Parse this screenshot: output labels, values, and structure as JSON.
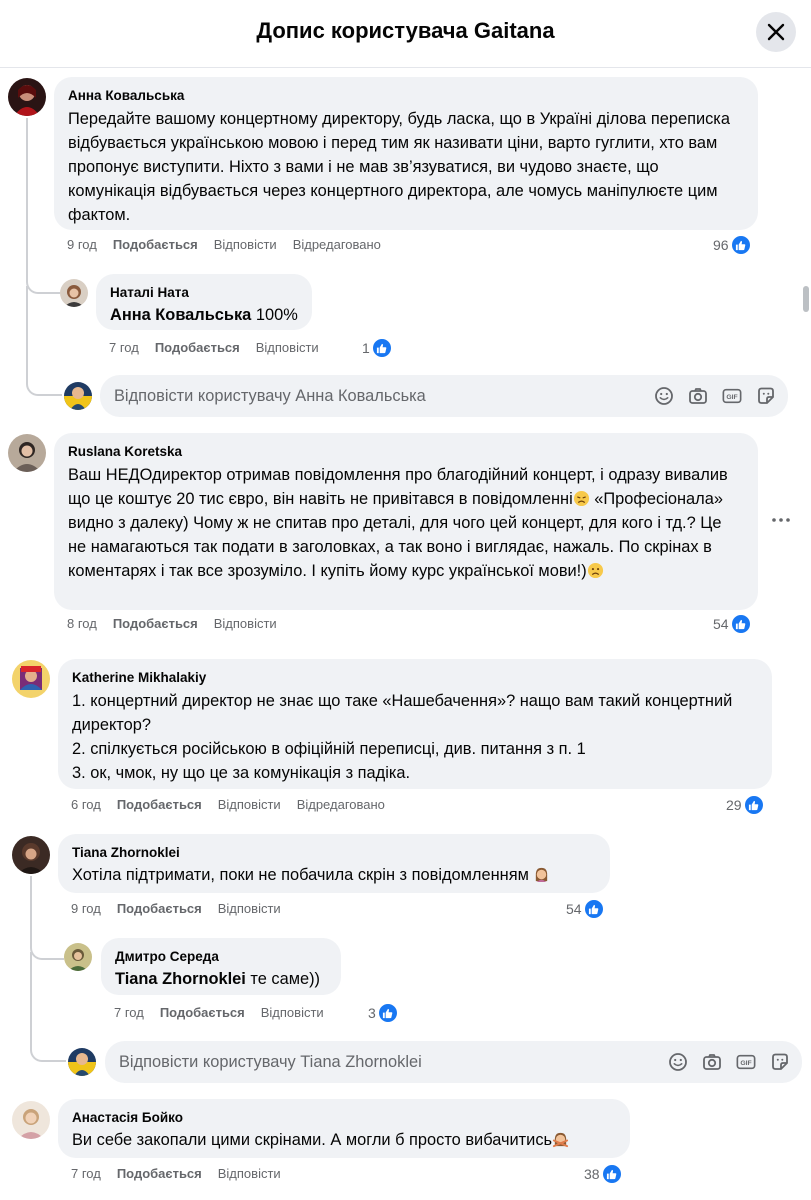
{
  "header": {
    "title": "Допис користувача Gaitana"
  },
  "colors": {
    "accent": "#1877f2",
    "bubble": "#f0f2f5",
    "meta": "#65676b"
  },
  "comments": [
    {
      "author": "Анна Ковальська",
      "text": "Передайте вашому концертному директору, будь ласка, що в Україні ділова переписка відбувається українською мовою і перед тим як називати ціни, варто гуглити, хто вам пропонує виступити. Ніхто з вами і не мав зв’язуватися, ви чудово знаєте, що комунікація відбувається через концертного директора, але чомусь маніпулюєте цим фактом.",
      "time": "9 год",
      "like": "Подобається",
      "reply": "Відповісти",
      "edited": "Відредаговано",
      "reactions": "96",
      "replies": [
        {
          "author": "Наталі Ната",
          "mention": "Анна Ковальська",
          "text": " 100%",
          "time": "7 год",
          "like": "Подобається",
          "reply": "Відповісти",
          "reactions": "1"
        }
      ],
      "reply_placeholder": "Відповісти користувачу Анна Ковальська"
    },
    {
      "author": "Ruslana Koretska",
      "text": "Ваш НЕДОдиректор отримав повідомлення про благодійний концерт, і одразу вивалив що це коштує 20 тис євро, він навіть не привітався в повідомленні",
      "text2": " «Професіонала» видно з далеку) Чому ж не спитав про деталі, для чого цей концерт, для кого і тд.? Це не намагаються так подати в заголовках, а так воно і виглядає, нажаль. По скрінах в коментарях і так все зрозуміло. І купіть йому курс української мови!)",
      "time": "8 год",
      "like": "Подобається",
      "reply": "Відповісти",
      "reactions": "54"
    },
    {
      "author": "Katherine Mikhalakiy",
      "lines": [
        "1. концертний директор не знає що таке «Нашебачення»? нащо вам такий концертний директор?",
        "2. спілкується російською в офіційній переписці, див. питання з п. 1",
        "3. ок, чмок, ну що це за комунікація з падіка."
      ],
      "time": "6 год",
      "like": "Подобається",
      "reply": "Відповісти",
      "edited": "Відредаговано",
      "reactions": "29"
    },
    {
      "author": "Tiana Zhornoklei",
      "text": "Хотіла підтримати, поки не побачила скрін з повідомленням ",
      "time": "9 год",
      "like": "Подобається",
      "reply": "Відповісти",
      "reactions": "54",
      "replies": [
        {
          "author": "Дмитро Середа",
          "mention": "Tiana Zhornoklei",
          "text": " те саме))",
          "time": "7 год",
          "like": "Подобається",
          "reply": "Відповісти",
          "reactions": "3"
        }
      ],
      "reply_placeholder": "Відповісти користувачу Tiana Zhornoklei"
    },
    {
      "author": "Анастасія Бойко",
      "text": "Ви себе закопали цими скрінами. А могли б просто вибачитись",
      "time": "7 год",
      "like": "Подобається",
      "reply": "Відповісти",
      "reactions": "38"
    }
  ],
  "icons": {
    "close": "close-icon",
    "like": "like-icon",
    "emoji": "emoji-icon",
    "camera": "camera-icon",
    "gif": "gif-icon",
    "sticker": "sticker-icon",
    "more": "more-icon"
  }
}
